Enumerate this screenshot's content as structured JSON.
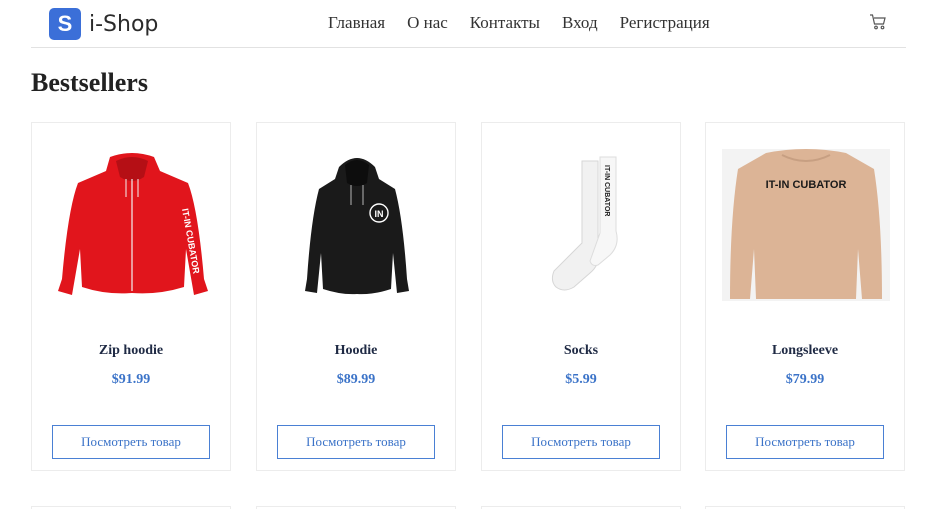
{
  "header": {
    "logo_letter": "S",
    "logo_text": "i-Shop",
    "nav": [
      "Главная",
      "О нас",
      "Контакты",
      "Вход",
      "Регистрация"
    ],
    "cart_icon": "cart-icon"
  },
  "main": {
    "title": "Bestsellers",
    "products": [
      {
        "name": "Zip hoodie",
        "price": "$91.99",
        "button": "Посмотреть товар",
        "image": "red-zip-hoodie"
      },
      {
        "name": "Hoodie",
        "price": "$89.99",
        "button": "Посмотреть товар",
        "image": "black-hoodie"
      },
      {
        "name": "Socks",
        "price": "$5.99",
        "button": "Посмотреть товар",
        "image": "white-socks"
      },
      {
        "name": "Longsleeve",
        "price": "$79.99",
        "button": "Посмотреть товар",
        "image": "beige-longsleeve"
      }
    ]
  },
  "image_text": {
    "zip_sleeve": "IT-IN CUBATOR",
    "hoodie_badge": "IN",
    "socks_text": "IT-IN CUBATOR",
    "longsleeve_text": "IT-IN CUBATOR"
  },
  "colors": {
    "accent": "#3b73c8",
    "logo": "#3b6fd8",
    "zip_hoodie": "#e1151c",
    "hoodie": "#1a1a1a",
    "longsleeve": "#dcb496"
  }
}
